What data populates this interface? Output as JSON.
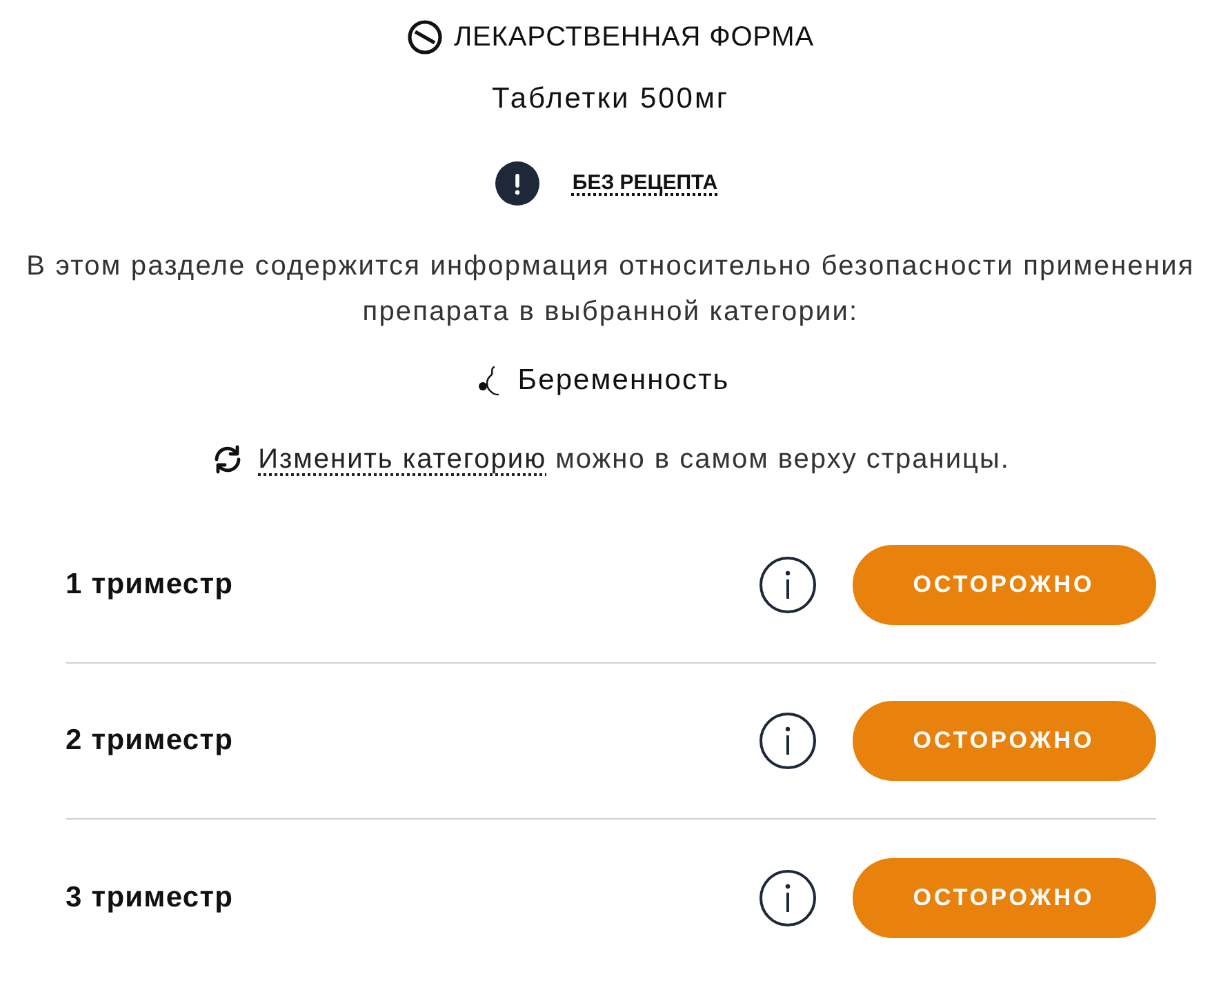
{
  "dosage_form": {
    "label": "ЛЕКАРСТВЕННАЯ ФОРМА",
    "value": "Таблетки 500мг"
  },
  "prescription": {
    "label": "БЕЗ РЕЦЕПТА"
  },
  "intro": "В этом разделе содержится информация относительно безопасности применения препарата в выбранной категории:",
  "category": {
    "kind": "pregnancy",
    "label": "Беременность"
  },
  "change_note": {
    "link": "Изменить категорию",
    "text": "можно в самом верху страницы."
  },
  "rows": [
    {
      "label": "1 триместр",
      "kind": "caution",
      "status": "ОСТОРОЖНО"
    },
    {
      "label": "2 триместр",
      "kind": "caution",
      "status": "ОСТОРОЖНО"
    },
    {
      "label": "3 триместр",
      "kind": "caution",
      "status": "ОСТОРОЖНО"
    }
  ]
}
